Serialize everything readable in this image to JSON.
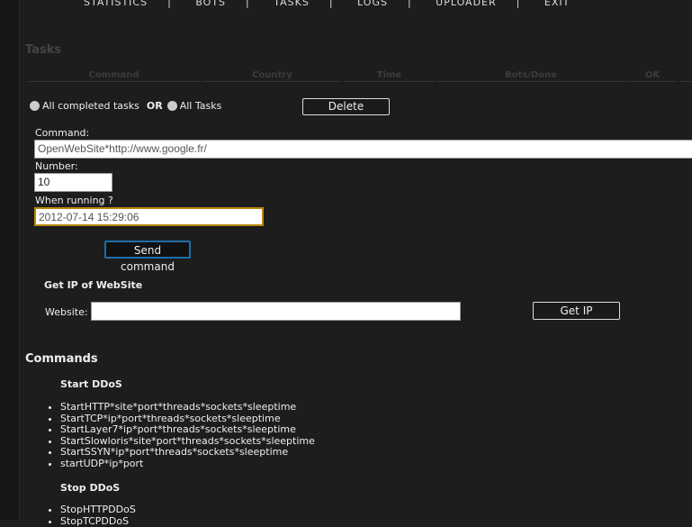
{
  "nav": [
    "STATISTICS",
    "BOTS",
    "TASKS",
    "LOGS",
    "UPLOADER",
    "EXIT"
  ],
  "tasks": {
    "title": "Tasks",
    "columns": [
      "Command",
      "Country",
      "Time",
      "Bots/Done",
      "OK"
    ]
  },
  "filter": {
    "completed": "All completed tasks",
    "or": "OR",
    "all": "All Tasks",
    "delete": "Delete"
  },
  "form": {
    "command_label": "Command:",
    "command_value": "OpenWebSite*http://www.google.fr/",
    "number_label": "Number:",
    "number_value": "10",
    "when_label": "When running ?",
    "when_value": "2012-07-14 15:29:06",
    "send": "Send command"
  },
  "getip": {
    "title": "Get IP of WebSite",
    "website_label": "Website:",
    "website_value": "",
    "button": "Get IP"
  },
  "commands": {
    "title": "Commands",
    "start_title": "Start DDoS",
    "start": [
      "StartHTTP*site*port*threads*sockets*sleeptime",
      "StartTCP*ip*port*threads*sockets*sleeptime",
      "StartLayer7*ip*port*threads*sockets*sleeptime",
      "StartSlowloris*site*port*threads*sockets*sleeptime",
      "StartSSYN*ip*port*threads*sockets*sleeptime",
      "startUDP*ip*port"
    ],
    "stop_title": "Stop DDoS",
    "stop": [
      "StopHTTPDDoS",
      "StopTCPDDoS"
    ]
  }
}
